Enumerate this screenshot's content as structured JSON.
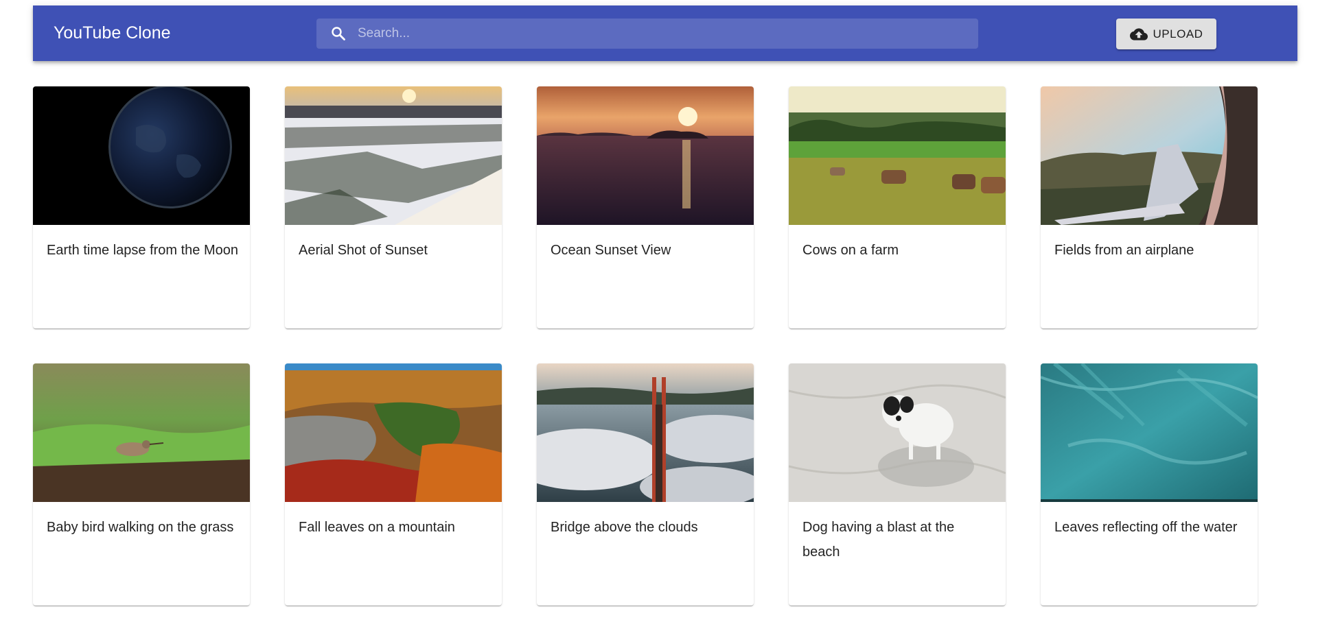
{
  "header": {
    "title": "YouTube Clone",
    "search_placeholder": "Search...",
    "upload_label": "UPLOAD",
    "bar_color": "#3f51b5",
    "search_bg_color": "#5c6bc0"
  },
  "videos": [
    {
      "title": "Earth time lapse from the Moon",
      "thumbnail": "earth-from-space"
    },
    {
      "title": "Aerial Shot of Sunset",
      "thumbnail": "snowy-forest-sunset"
    },
    {
      "title": "Ocean Sunset View",
      "thumbnail": "ocean-sunset-island"
    },
    {
      "title": "Cows on a farm",
      "thumbnail": "cows-grazing-field"
    },
    {
      "title": "Fields from an airplane",
      "thumbnail": "airplane-wing-over-fields"
    },
    {
      "title": "Baby bird walking on the grass",
      "thumbnail": "bird-on-grass"
    },
    {
      "title": "Fall leaves on a mountain",
      "thumbnail": "autumn-forest-cliffs"
    },
    {
      "title": "Bridge above the clouds",
      "thumbnail": "golden-gate-fog"
    },
    {
      "title": "Dog having a blast at the beach",
      "thumbnail": "dog-on-sand"
    },
    {
      "title": "Leaves reflecting off the water",
      "thumbnail": "palm-leaves-teal-water"
    }
  ]
}
